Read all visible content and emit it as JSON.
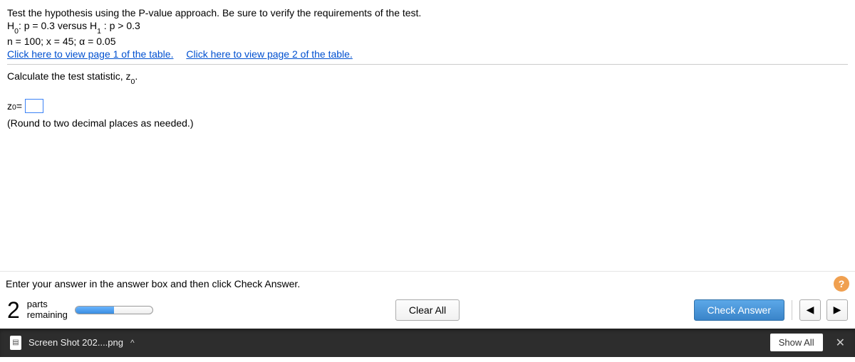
{
  "question": {
    "intro": "Test the hypothesis using the P-value approach. Be sure to verify the requirements of the test.",
    "hypothesis_prefix": "H",
    "h0_sub": "0",
    "h0_text": ": p = 0.3 versus H",
    "h1_sub": "1",
    "h1_text": " : p > 0.3",
    "params": "n = 100; x = 45; α = 0.05",
    "link1": "Click here to view page 1 of the table.",
    "link2": "Click here to view page 2 of the table.",
    "calc_prefix": "Calculate the test statistic, z",
    "calc_sub": "0",
    "calc_suffix": ".",
    "z_label_prefix": "z",
    "z_label_sub": "0",
    "z_label_suffix": " = ",
    "round_note": "(Round to two decimal places as needed.)"
  },
  "footer": {
    "prompt": "Enter your answer in the answer box and then click Check Answer.",
    "help": "?",
    "parts_count": "2",
    "parts_label_top": "parts",
    "parts_label_bottom": "remaining",
    "clear_all": "Clear All",
    "check_answer": "Check Answer",
    "nav_prev": "◀",
    "nav_next": "▶"
  },
  "downloads": {
    "file_name": "Screen Shot 202....png",
    "chevron": "^",
    "show_all": "Show All",
    "close": "✕"
  }
}
